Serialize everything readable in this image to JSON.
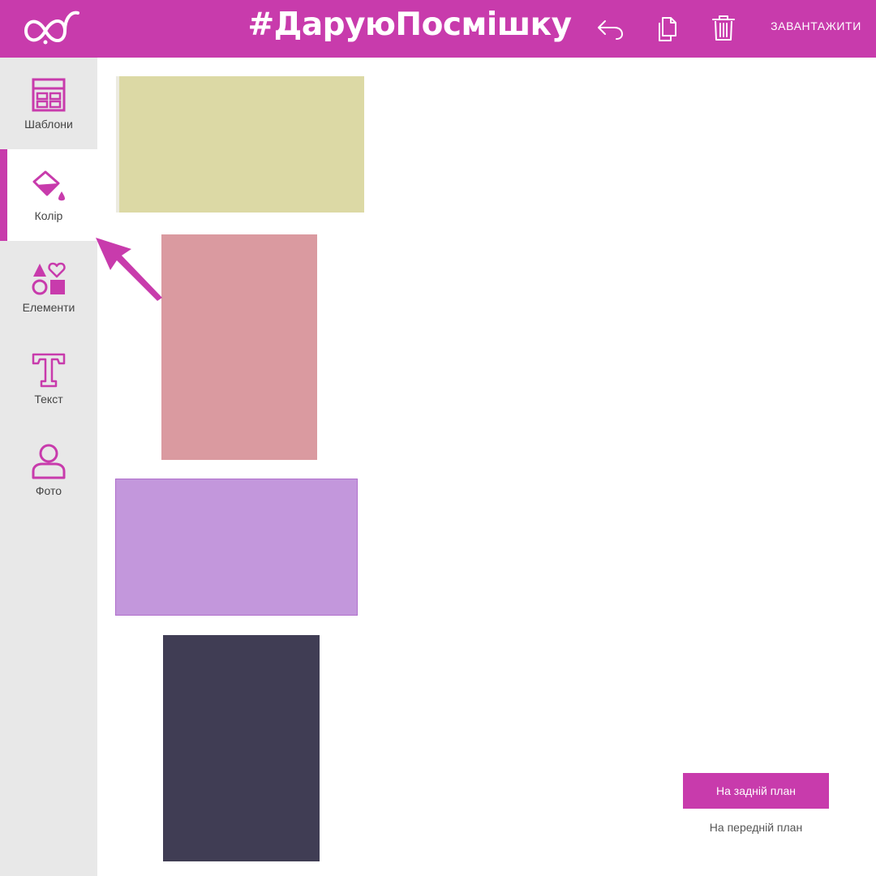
{
  "header": {
    "title": "#ДаруюПосмішку",
    "download_label": "ЗАВАНТАЖИТИ",
    "icons": [
      "logo-icon",
      "undo-icon",
      "duplicate-icon",
      "trash-icon"
    ]
  },
  "sidebar": {
    "items": [
      {
        "label": "Шаблони",
        "icon": "templates-icon",
        "active": false
      },
      {
        "label": "Колір",
        "icon": "paint-bucket-icon",
        "active": true
      },
      {
        "label": "Елементи",
        "icon": "shapes-icon",
        "active": false
      },
      {
        "label": "Текст",
        "icon": "text-icon",
        "active": false
      },
      {
        "label": "Фото",
        "icon": "user-icon",
        "active": false
      }
    ]
  },
  "canvas": {
    "swatches": [
      {
        "name": "khaki",
        "color": "#dcd9a5"
      },
      {
        "name": "dusty-pink",
        "color": "#da9aa0"
      },
      {
        "name": "lavender",
        "color": "#c397dc"
      },
      {
        "name": "dark-slate",
        "color": "#403d54"
      }
    ]
  },
  "layer_controls": {
    "send_back_label": "На задній план",
    "bring_front_label": "На передній план"
  },
  "colors": {
    "accent": "#c83bac",
    "sidebar_bg": "#e8e8e8",
    "canvas_bg": "#ffffff"
  }
}
